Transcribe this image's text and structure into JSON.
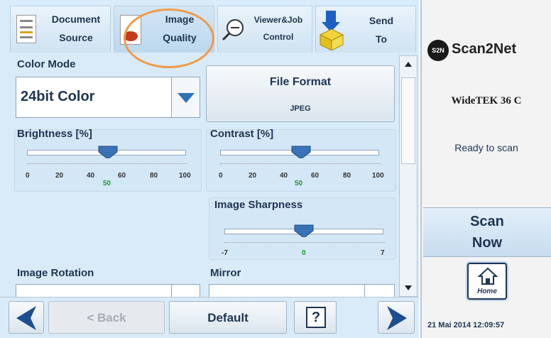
{
  "tabs": [
    {
      "line1": "Document",
      "line2": "Source",
      "icon": "document-source-icon"
    },
    {
      "line1": "Image",
      "line2": "Quality",
      "icon": "image-quality-icon"
    },
    {
      "line1": "Viewer&Job",
      "line2": "Control",
      "icon": "zoom-icon"
    },
    {
      "line1": "Send",
      "line2": "To",
      "icon": "send-box-icon"
    }
  ],
  "color_mode": {
    "title": "Color Mode",
    "value": "24bit Color"
  },
  "file_format": {
    "title": "File Format",
    "value": "JPEG"
  },
  "brightness": {
    "title": "Brightness [%]",
    "ticks": [
      "0",
      "20",
      "40",
      "60",
      "80",
      "100"
    ],
    "value": "50"
  },
  "contrast": {
    "title": "Contrast [%]",
    "ticks": [
      "0",
      "20",
      "40",
      "60",
      "80",
      "100"
    ],
    "value": "50"
  },
  "sharpness": {
    "title": "Image Sharpness",
    "min": "-7",
    "max": "7",
    "value": "0"
  },
  "rotation": {
    "title": "Image Rotation"
  },
  "mirror": {
    "title": "Mirror"
  },
  "bottom": {
    "back": "< Back",
    "default": "Default",
    "help": "?"
  },
  "right": {
    "brand": "Scan2Net",
    "brand_mark": "S2N",
    "model": "WideTEK 36 C",
    "status": "Ready to scan",
    "scan_now_line1": "Scan",
    "scan_now_line2": "Now",
    "home": "Home",
    "datetime": "21 Mai 2014 12:09:57"
  },
  "colors": {
    "panel": "#d9ebf8",
    "accent_blue": "#2f5f9a",
    "value_green": "#1b9a2a",
    "highlight_ring": "#f19a48"
  }
}
